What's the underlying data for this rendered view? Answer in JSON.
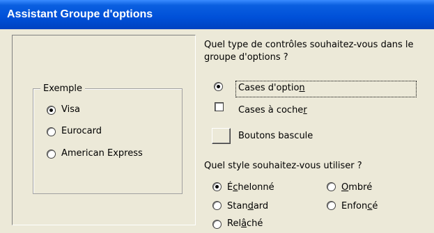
{
  "window": {
    "title": "Assistant Groupe d'options"
  },
  "preview": {
    "group_legend": "Exemple",
    "options": [
      {
        "label": "Visa",
        "checked": true
      },
      {
        "label": "Eurocard",
        "checked": false
      },
      {
        "label": "American Express",
        "checked": false
      }
    ]
  },
  "controls": {
    "question_line1": "Quel type de contrôles souhaitez-vous dans le",
    "question_line2": "groupe d'options ?",
    "option_buttons": {
      "label_pre": "Cases d'optio",
      "label_key": "n",
      "checked": true
    },
    "check_boxes": {
      "label_pre": "Cases à coche",
      "label_key": "r"
    },
    "toggle_buttons": {
      "label": "Boutons bascule"
    }
  },
  "style": {
    "question": "Quel style souhaitez-vous utiliser ?",
    "etched": {
      "pre": "É",
      "key": "c",
      "post": "helonné",
      "checked": true
    },
    "shadowed": {
      "pre": "",
      "key": "O",
      "post": "mbré"
    },
    "flat": {
      "pre": "Stan",
      "key": "d",
      "post": "ard"
    },
    "sunken": {
      "pre": "Enfon",
      "key": "c",
      "post": "é"
    },
    "raised": {
      "pre": "Rel",
      "key": "â",
      "post": "ché"
    }
  }
}
